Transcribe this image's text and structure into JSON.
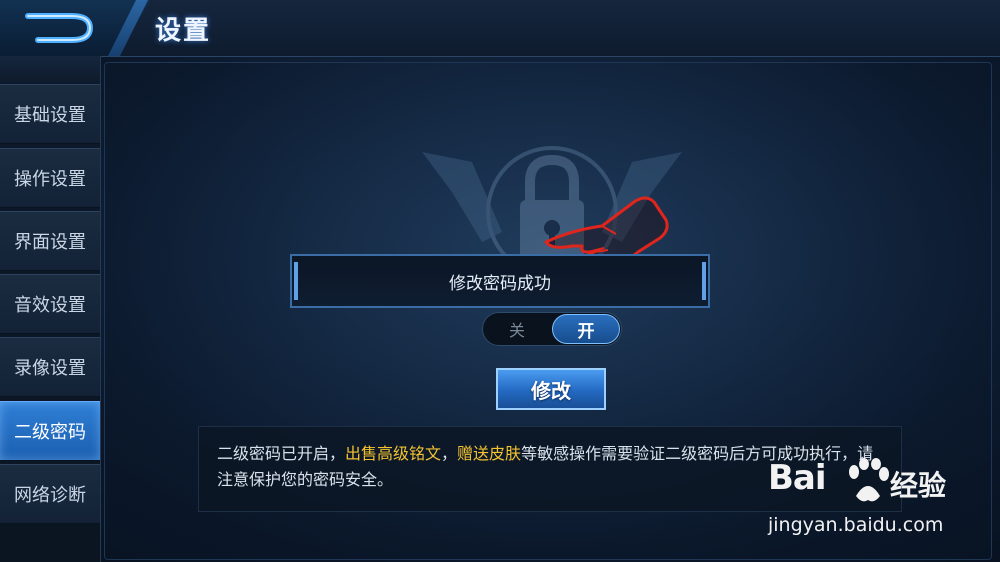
{
  "header": {
    "title": "设置"
  },
  "sidebar": {
    "items": [
      {
        "label": "基础设置",
        "active": false
      },
      {
        "label": "操作设置",
        "active": false
      },
      {
        "label": "界面设置",
        "active": false
      },
      {
        "label": "音效设置",
        "active": false
      },
      {
        "label": "录像设置",
        "active": false
      },
      {
        "label": "二级密码",
        "active": true
      },
      {
        "label": "网络诊断",
        "active": false
      }
    ]
  },
  "main": {
    "banner_text": "修改密码成功",
    "toggle": {
      "off_label": "关",
      "on_label": "开",
      "state": "on"
    },
    "modify_button": "修改",
    "info": {
      "part1": "二级密码已开启，",
      "highlight1": "出售高级铭文",
      "sep": "，",
      "highlight2": "赠送皮肤",
      "part2": "等敏感操作需要验证二级密码后方可成功执行，请注意保护您的密码安全。"
    }
  },
  "watermark": {
    "logo": "Bai",
    "logo_cn": "经验",
    "url": "jingyan.baidu.com"
  },
  "colors": {
    "accent": "#2f7fd6",
    "highlight": "#f2c230",
    "pointer": "#e0261c"
  },
  "icons": [
    "back-arrow-icon",
    "lock-emblem-icon",
    "pointing-hand-icon",
    "baidu-paw-icon"
  ]
}
